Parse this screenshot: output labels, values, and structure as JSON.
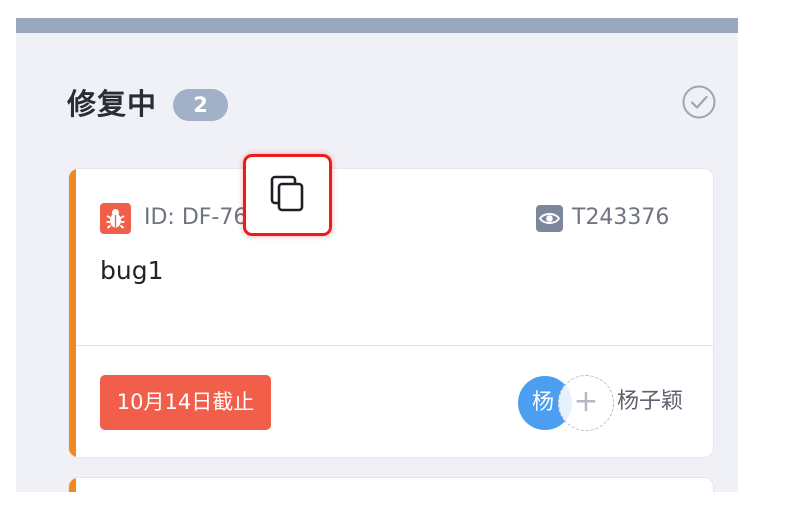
{
  "column": {
    "title": "修复中",
    "count": "2",
    "done_icon": "check-circle-icon"
  },
  "cards": [
    {
      "type_icon": "bug-icon",
      "id_label": "ID: DF-765",
      "copy_icon": "copy-icon",
      "watch_icon": "eye-icon",
      "task_id": "T243376",
      "title": "bug1",
      "due": "10月14日截止",
      "assignee_avatar": "杨",
      "add_assignee": "+",
      "assignee_name": "杨子颖",
      "accent_color": "#ef8a23"
    }
  ],
  "colors": {
    "column_bg": "#f0f1f6",
    "badge": "#a3b1c8",
    "due_tag": "#f15f4b",
    "avatar": "#4b9ef0",
    "highlight": "#ee1b1b"
  }
}
